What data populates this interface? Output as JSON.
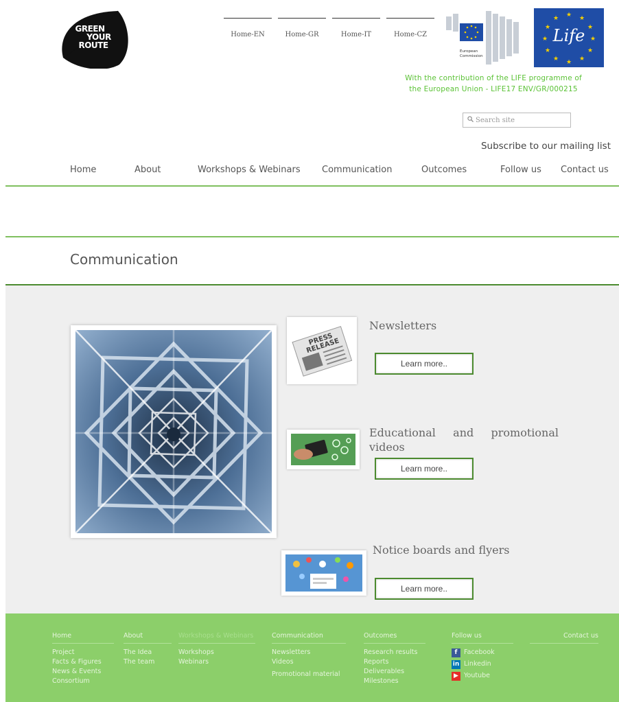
{
  "header": {
    "logo_text": [
      "GREEN",
      "YOUR",
      "ROUTE"
    ],
    "languages": [
      "Home-EN",
      "Home-GR",
      "Home-IT",
      "Home-CZ"
    ],
    "ec_logo_text": [
      "European",
      "Commission"
    ],
    "life_logo_text": "Life",
    "contribution": [
      "With the contribution of the LIFE programme of",
      "the European Union - LIFE17 ENV/GR/000215"
    ],
    "search_placeholder": "Search site",
    "subscribe": "Subscribe to our mailing list"
  },
  "nav": [
    "Home",
    "About",
    "Workshops & Webinars",
    "Communication",
    "Outcomes",
    "Follow us",
    "Contact us"
  ],
  "page_title": "Communication",
  "sections": [
    {
      "title": "Newsletters",
      "thumb_text": [
        "PRESS",
        "RELEASE"
      ],
      "button": "Learn more.."
    },
    {
      "title": "Educational and promotional videos",
      "button": "Learn more.."
    },
    {
      "title": "Notice boards and flyers",
      "button": "Learn more.."
    }
  ],
  "footer": {
    "columns": [
      {
        "head": "Home",
        "items": [
          "Project",
          "Facts & Figures",
          "News & Events",
          "Consortium"
        ]
      },
      {
        "head": "About",
        "items": [
          "The Idea",
          "The team"
        ]
      },
      {
        "head": "Workshops & Webinars",
        "items": [
          "Workshops",
          "Webinars"
        ]
      },
      {
        "head": "Communication",
        "items": [
          "Newsletters",
          "Videos",
          "Promotional material"
        ]
      },
      {
        "head": "Outcomes",
        "items": [
          "Research results",
          "Reports",
          "Deliverables",
          "Milestones"
        ]
      },
      {
        "head": "Follow us",
        "items": [
          "Facebook",
          "Linkedin",
          "Youtube"
        ]
      },
      {
        "head": "Contact us",
        "items": []
      }
    ]
  },
  "colors": {
    "green_accent": "#7fbf5e",
    "green_dark": "#4b8a2e",
    "footer_green": "#8ccf6a",
    "contribution_green": "#5bc236"
  }
}
